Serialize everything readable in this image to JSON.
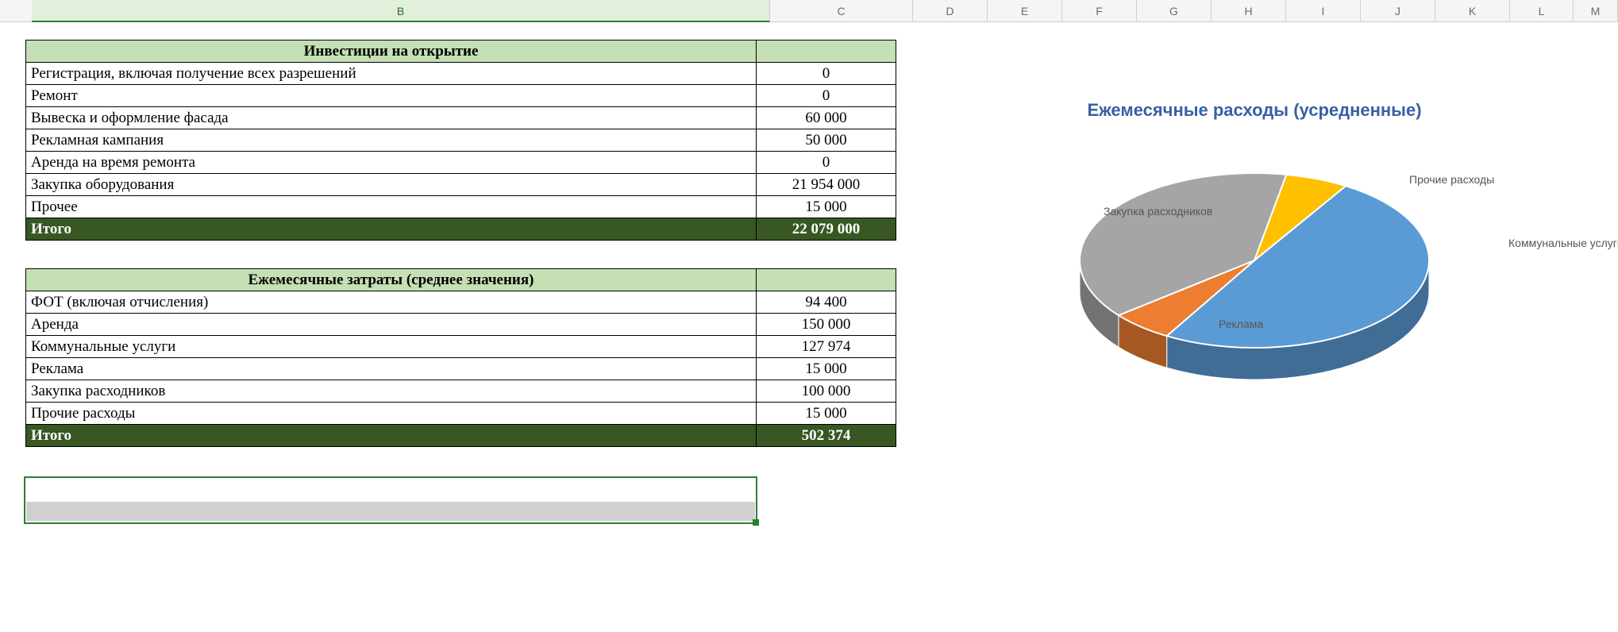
{
  "columns": [
    "B",
    "C",
    "D",
    "E",
    "F",
    "G",
    "H",
    "I",
    "J",
    "K",
    "L",
    "M"
  ],
  "active_column": "B",
  "table1": {
    "header": "Инвестиции на открытие",
    "rows": [
      {
        "label": "Регистрация, включая получение всех разрешений",
        "value": "0"
      },
      {
        "label": "Ремонт",
        "value": "0"
      },
      {
        "label": "Вывеска и оформление фасада",
        "value": "60 000"
      },
      {
        "label": "Рекламная кампания",
        "value": "50 000"
      },
      {
        "label": "Аренда на время ремонта",
        "value": "0"
      },
      {
        "label": "Закупка оборудования",
        "value": "21 954 000"
      },
      {
        "label": "Прочее",
        "value": "15 000"
      }
    ],
    "total_label": "Итого",
    "total_value": "22 079 000"
  },
  "table2": {
    "header": "Ежемесячные затраты (среднее значения)",
    "rows": [
      {
        "label": "ФОТ (включая отчисления)",
        "value": "94 400"
      },
      {
        "label": "Аренда",
        "value": "150 000"
      },
      {
        "label": "Коммунальные услуги",
        "value": "127 974"
      },
      {
        "label": "Реклама",
        "value": "15 000"
      },
      {
        "label": "Закупка расходников",
        "value": "100 000"
      },
      {
        "label": "Прочие расходы",
        "value": "15 000"
      }
    ],
    "total_label": "Итого",
    "total_value": "502 374"
  },
  "chart_data": {
    "type": "pie",
    "title": "Ежемесячные расходы (усредненные)",
    "series": [
      {
        "name": "Коммунальные услуги",
        "value": 127974,
        "color": "#5b9bd5"
      },
      {
        "name": "Реклама",
        "value": 15000,
        "color": "#ed7d31"
      },
      {
        "name": "Закупка расходников",
        "value": 100000,
        "color": "#a5a5a5"
      },
      {
        "name": "Прочие расходы",
        "value": 15000,
        "color": "#ffc000"
      }
    ]
  }
}
